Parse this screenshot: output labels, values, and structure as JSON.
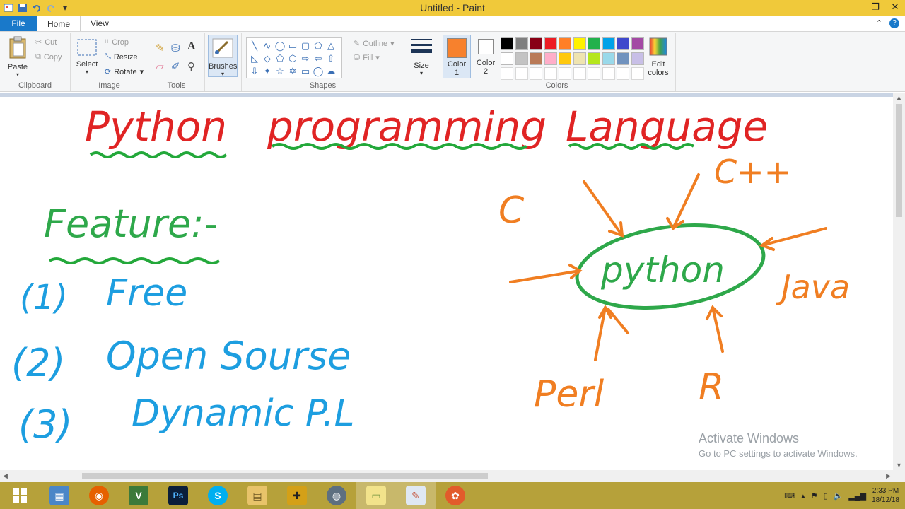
{
  "window": {
    "title": "Untitled - Paint"
  },
  "qat": {
    "icons": [
      "paint-app-icon",
      "save-icon",
      "undo-icon",
      "redo-icon",
      "customize-qat-icon"
    ]
  },
  "tabs": {
    "file": "File",
    "home": "Home",
    "view": "View"
  },
  "clipboard": {
    "paste": "Paste",
    "cut": "Cut",
    "copy": "Copy",
    "label": "Clipboard"
  },
  "image": {
    "select": "Select",
    "crop": "Crop",
    "resize": "Resize",
    "rotate": "Rotate",
    "label": "Image"
  },
  "tools": {
    "label": "Tools"
  },
  "brushes": {
    "label": "Brushes"
  },
  "shapes": {
    "outline": "Outline",
    "fill": "Fill",
    "label": "Shapes"
  },
  "size": {
    "label": "Size"
  },
  "colors": {
    "color1": "Color",
    "color1_num": "1",
    "color2": "Color",
    "color2_num": "2",
    "edit": "Edit colors",
    "label": "Colors",
    "color1_value": "#f7812d",
    "color2_value": "#ffffff",
    "palette_row1": [
      "#000000",
      "#7f7f7f",
      "#880015",
      "#ed1c24",
      "#ff7f27",
      "#fff200",
      "#22b14c",
      "#00a2e8",
      "#3f48cc",
      "#a349a4"
    ],
    "palette_row2": [
      "#ffffff",
      "#c3c3c3",
      "#b97a57",
      "#ffaec9",
      "#ffc90e",
      "#efe4b0",
      "#b5e61d",
      "#99d9ea",
      "#7092be",
      "#c8bfe7"
    ]
  },
  "drawing": {
    "title_words": [
      "Python",
      "programming",
      "Language"
    ],
    "feature": "Feature:-",
    "items": [
      {
        "num": "(1)",
        "text": "Free"
      },
      {
        "num": "(2)",
        "text": "Open Sourse"
      },
      {
        "num": "(3)",
        "text": "Dynamic P.L"
      }
    ],
    "center": "python",
    "influences": [
      "C",
      "C++",
      "Java",
      "Perl",
      "R"
    ]
  },
  "watermark": {
    "line1": "Activate Windows",
    "line2": "Go to PC settings to activate Windows."
  },
  "taskbar": {
    "apps": [
      "windows-start-icon",
      "control-panel-icon",
      "firefox-icon",
      "vs-icon",
      "photoshop-icon",
      "skype-icon",
      "file-explorer-icon",
      "folder-tool-icon",
      "globe-icon",
      "sticky-notes-icon",
      "paint-icon",
      "settings-flower-icon"
    ],
    "time": "2:33 PM",
    "date": "18/12/18"
  }
}
